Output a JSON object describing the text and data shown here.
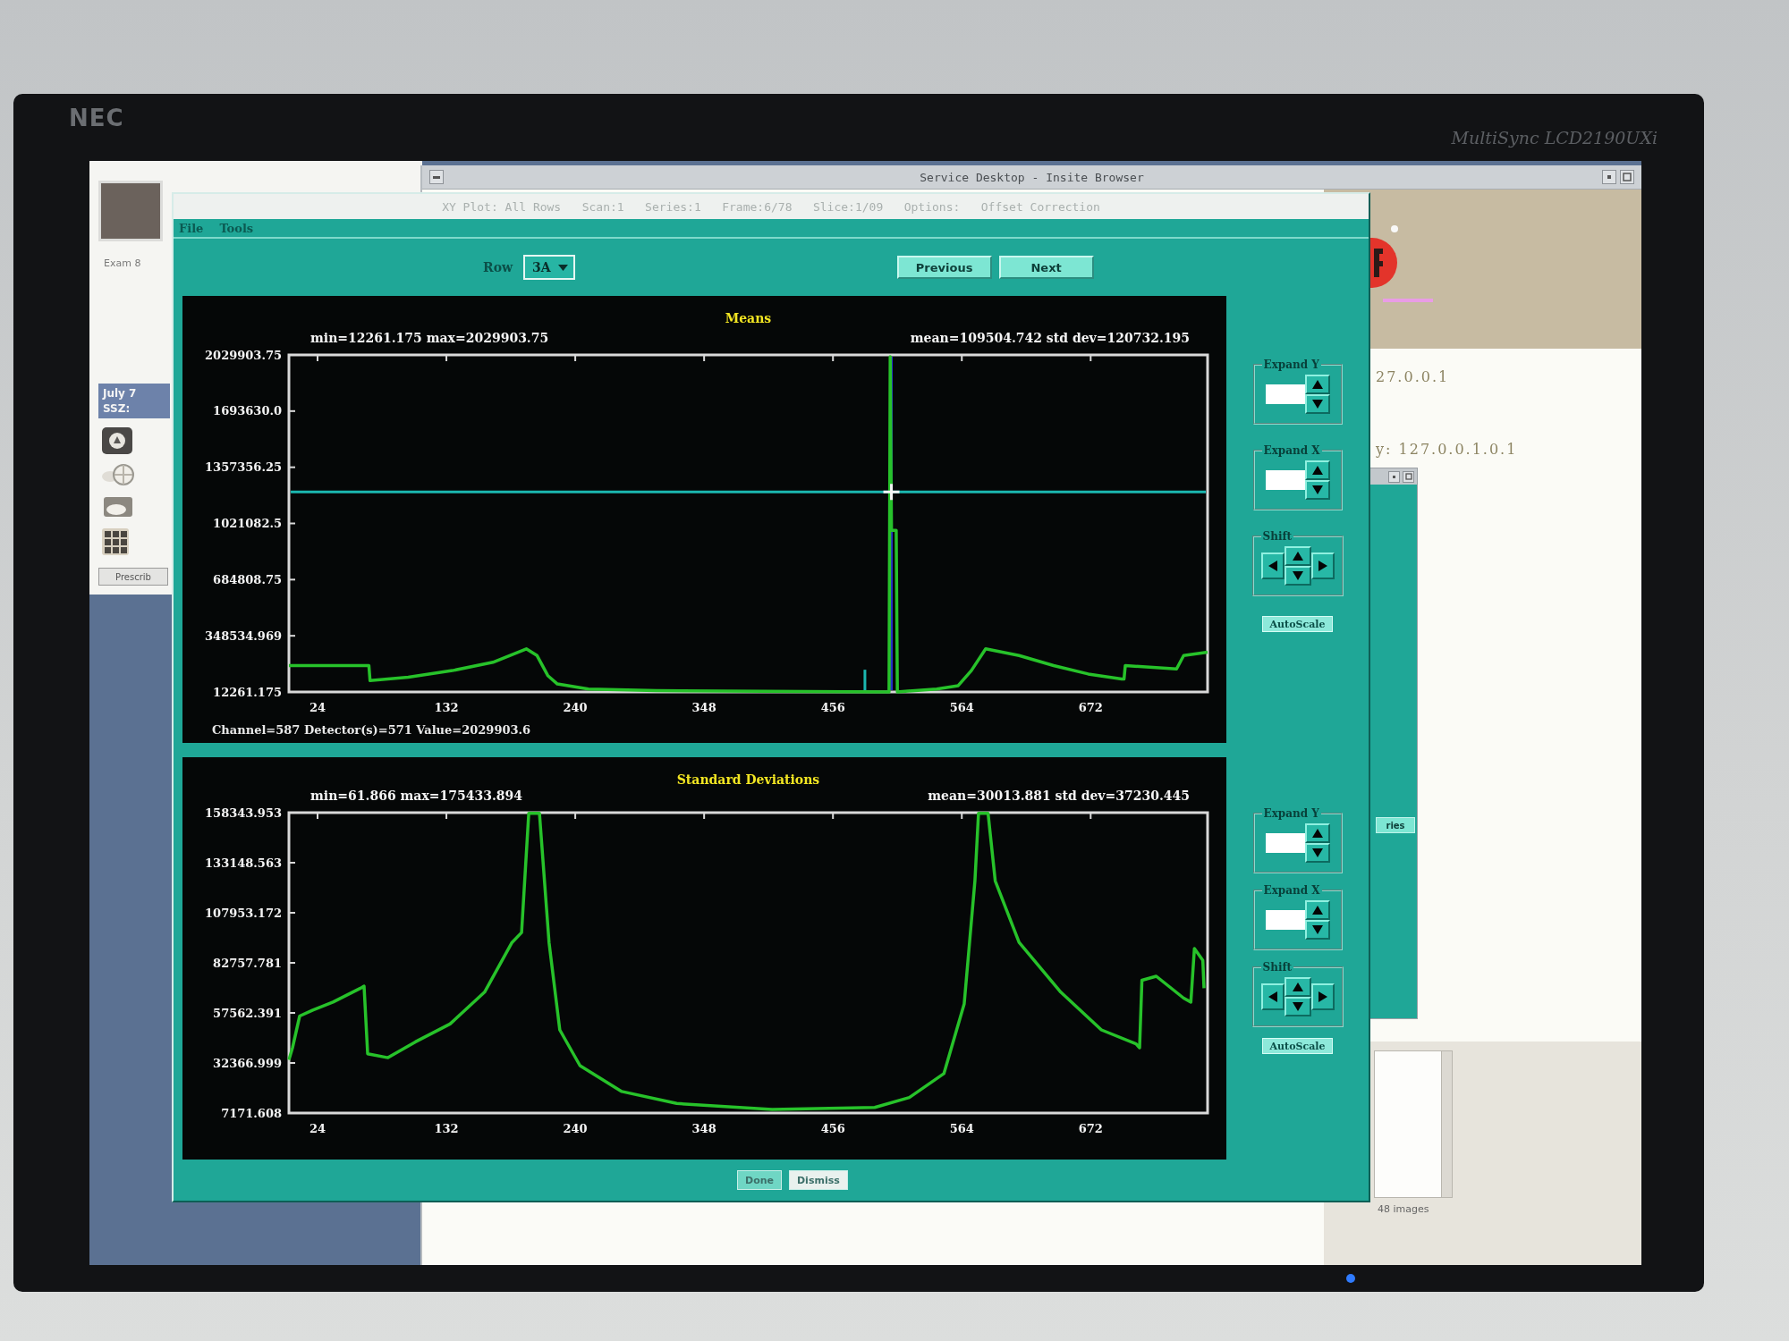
{
  "monitor": {
    "brand": "NEC",
    "model": "MultiSync LCD2190UXi"
  },
  "side_panel": {
    "label": "Exam 8",
    "date": "July 7",
    "line_2": "SSZ:",
    "button": "Prescrib"
  },
  "browser_window": {
    "title": "Service Desktop - Insite Browser",
    "address_lines": [
      "27.0.0.1",
      "y: 127.0.0.1.0.1"
    ],
    "side_button": "ries",
    "list_caption": "48 images"
  },
  "plot_window": {
    "title": "XY Plot: All Rows   Scan:1   Series:1   Frame:6/78   Slice:1/09   Options:   Offset Correction",
    "menu": [
      "File",
      "Tools"
    ],
    "row": {
      "label": "Row",
      "value": "3A"
    },
    "nav_buttons": [
      "Previous",
      "Next"
    ],
    "charts": [
      {
        "min_max": "min=12261.175 max=2029903.75",
        "mean_std": "mean=109504.742 std dev=120732.195",
        "readout": "Channel=587 Detector(s)=571 Value=2029903.6",
        "chart_data": {
          "type": "line",
          "title": "Means",
          "x": [
            0,
            67,
            68,
            100,
            137,
            171,
            199,
            208,
            217,
            225,
            251,
            308,
            503,
            504,
            505,
            509,
            510,
            543,
            561,
            572,
            584,
            612,
            641,
            670,
            698,
            700,
            701,
            744,
            750,
            770
          ],
          "series": [
            {
              "color": "#27c22a",
              "values": [
                170000,
                170000,
                80000,
                100000,
                140000,
                190000,
                270000,
                230000,
                110000,
                60000,
                30000,
                20000,
                13000,
                2020000,
                980000,
                980000,
                13000,
                30000,
                50000,
                140000,
                270000,
                230000,
                170000,
                120000,
                90000,
                90000,
                170000,
                150000,
                230000,
                250000
              ]
            }
          ],
          "xlim": [
            0,
            770
          ],
          "ylim": [
            12261.175,
            2029903.75
          ],
          "xticks": [
            24,
            132,
            240,
            348,
            456,
            564,
            672
          ],
          "yticks": [
            2029903.75,
            {
              "value": 1693630.0,
              "label": "1693630.0"
            },
            1357356.25,
            1021082.5,
            684808.75,
            348534.969,
            12261.175
          ],
          "ref_lines": [
            {
              "axis": "y",
              "value": 1210000,
              "color": "#1bb7b0"
            },
            {
              "axis": "x",
              "value": 505,
              "color": "#2531c8"
            }
          ]
        },
        "controls": {
          "groups": [
            {
              "kind": "spinner",
              "label": "Expand Y"
            },
            {
              "kind": "spinner",
              "label": "Expand X"
            },
            {
              "kind": "pad",
              "label": "Shift"
            }
          ],
          "button": "AutoScale"
        }
      },
      {
        "min_max": "min=61.866 max=175433.894",
        "mean_std": "mean=30013.881 std dev=37230.445",
        "chart_data": {
          "type": "line",
          "title": "Standard Deviations",
          "x": [
            0,
            3,
            9,
            20,
            37,
            60,
            63,
            66,
            83,
            106,
            135,
            164,
            187,
            195,
            201,
            210,
            218,
            227,
            244,
            279,
            325,
            405,
            491,
            520,
            549,
            566,
            575,
            578,
            586,
            592,
            612,
            647,
            681,
            710,
            713,
            715,
            727,
            750,
            756,
            759,
            766,
            767
          ],
          "series": [
            {
              "color": "#27c22a",
              "values": [
                34000,
                40000,
                56000,
                59000,
                63000,
                70000,
                71000,
                37000,
                35000,
                43000,
                52000,
                68000,
                93000,
                98000,
                158000,
                158000,
                93000,
                49000,
                31000,
                18000,
                12000,
                9000,
                10000,
                15000,
                27000,
                62000,
                124000,
                158000,
                158000,
                124000,
                93000,
                68000,
                49000,
                42000,
                40000,
                74000,
                76000,
                65000,
                63000,
                90000,
                84000,
                70000
              ]
            }
          ],
          "xlim": [
            0,
            770
          ],
          "ylim": [
            7171.608,
            158343.953
          ],
          "xticks": [
            24,
            132,
            240,
            348,
            456,
            564,
            672
          ],
          "yticks": [
            158343.953,
            133148.563,
            107953.172,
            82757.781,
            57562.391,
            32366.999,
            7171.608
          ]
        },
        "controls": {
          "groups": [
            {
              "kind": "spinner",
              "label": "Expand Y"
            },
            {
              "kind": "spinner",
              "label": "Expand X"
            },
            {
              "kind": "pad",
              "label": "Shift"
            }
          ],
          "button": "AutoScale"
        }
      }
    ],
    "footer_buttons": [
      "Done",
      "Dismiss"
    ]
  }
}
